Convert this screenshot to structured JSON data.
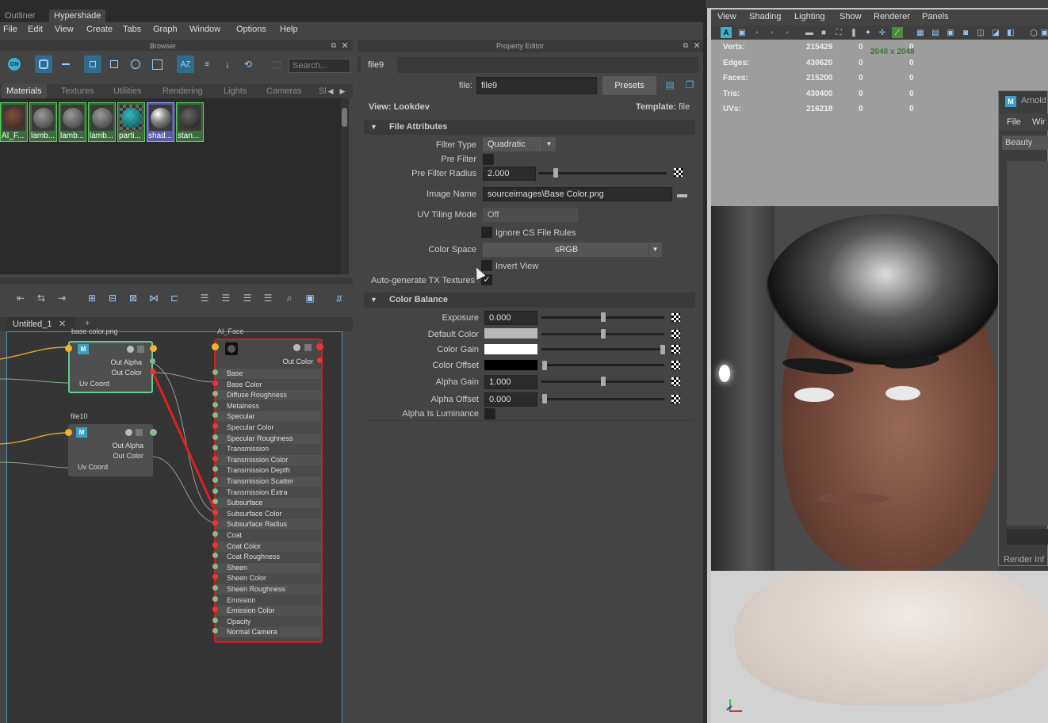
{
  "top_tabs": [
    "Outliner",
    "Hypershade"
  ],
  "menubar": [
    "File",
    "Edit",
    "View",
    "Create",
    "Tabs",
    "Graph",
    "Window",
    "Options",
    "Help"
  ],
  "browser": {
    "title": "Browser",
    "search_placeholder": "Search...",
    "tabs": [
      "Materials",
      "Textures",
      "Utilities",
      "Rendering",
      "Lights",
      "Cameras",
      "Sl"
    ],
    "swatches": [
      {
        "label": "AI_F...",
        "color": "#5a3a30"
      },
      {
        "label": "lamb...",
        "color": "#6a6a6a"
      },
      {
        "label": "lamb...",
        "color": "#6a6a6a"
      },
      {
        "label": "lamb...",
        "color": "#6a6a6a"
      },
      {
        "label": "parti...",
        "color": "#2a7a7a"
      },
      {
        "label": "shad...",
        "color": "#cfcfcf"
      },
      {
        "label": "stan...",
        "color": "#454545"
      }
    ]
  },
  "graph": {
    "tab": "Untitled_1",
    "add": "+",
    "node1": {
      "title": "base color.png",
      "rows": [
        "Out Alpha",
        "Out Color",
        "Uv Coord"
      ]
    },
    "node2": {
      "title": "file10",
      "rows": [
        "Out Alpha",
        "Out Color",
        "Uv Coord"
      ]
    },
    "node3": {
      "title": "AI_Face",
      "out": "Out Color",
      "rows": [
        "Base",
        "Base Color",
        "Diffuse Roughness",
        "Metalness",
        "Specular",
        "Specular Color",
        "Specular Roughness",
        "Transmission",
        "Transmission Color",
        "Transmission Depth",
        "Transmission Scatter",
        "Transmission Extra Roughness",
        "Subsurface",
        "Subsurface Color",
        "Subsurface Radius",
        "Coat",
        "Coat Color",
        "Coat Roughness",
        "Sheen",
        "Sheen Color",
        "Sheen Roughness",
        "Emission",
        "Emission Color",
        "Opacity",
        "Normal Camera"
      ]
    }
  },
  "property_editor": {
    "title": "Property Editor",
    "tab": "file9",
    "file_label": "file:",
    "file_value": "file9",
    "presets": "Presets",
    "view": "View: Lookdev",
    "template_label": "Template:",
    "template_value": "file",
    "file_attributes": {
      "header": "File Attributes",
      "filter_type_label": "Filter Type",
      "filter_type": "Quadratic",
      "pre_filter_label": "Pre Filter",
      "pre_filter_radius_label": "Pre Filter Radius",
      "pre_filter_radius": "2.000",
      "image_name_label": "Image Name",
      "image_name": "sourceimages\\Base Color.png",
      "uv_tiling_label": "UV Tiling Mode",
      "uv_tiling": "Off",
      "ignore_cs": "Ignore CS File Rules",
      "color_space_label": "Color Space",
      "color_space": "sRGB",
      "invert_view": "Invert View",
      "auto_tx": "Auto-generate TX Textures"
    },
    "color_balance": {
      "header": "Color Balance",
      "exposure_label": "Exposure",
      "exposure": "0.000",
      "default_color_label": "Default Color",
      "color_gain_label": "Color Gain",
      "color_offset_label": "Color Offset",
      "alpha_gain_label": "Alpha Gain",
      "alpha_gain": "1.000",
      "alpha_offset_label": "Alpha Offset",
      "alpha_offset": "0.000",
      "alpha_lum_label": "Alpha Is Luminance"
    }
  },
  "viewport": {
    "menu": [
      "View",
      "Shading",
      "Lighting",
      "Show",
      "Renderer",
      "Panels"
    ],
    "resolution": "2048 x 2048",
    "stats": [
      {
        "label": "Verts:",
        "a": "215429",
        "b": "0",
        "c": "0"
      },
      {
        "label": "Edges:",
        "a": "430620",
        "b": "0",
        "c": "0"
      },
      {
        "label": "Faces:",
        "a": "215200",
        "b": "0",
        "c": "0"
      },
      {
        "label": "Tris:",
        "a": "430400",
        "b": "0",
        "c": "0"
      },
      {
        "label": "UVs:",
        "a": "216218",
        "b": "0",
        "c": "0"
      }
    ],
    "arnold": {
      "title": "Arnold",
      "menu_file": "File",
      "menu_win": "Wir",
      "aov": "Beauty",
      "footer": "Render Inf"
    }
  }
}
